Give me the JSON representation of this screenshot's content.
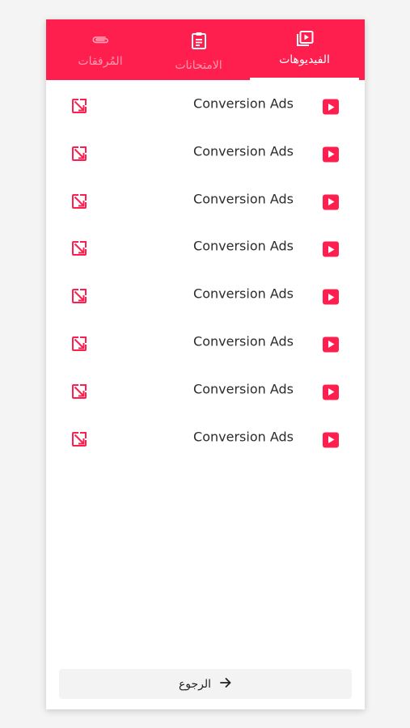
{
  "colors": {
    "accent": "#ff1f4f",
    "tab_inactive_text": "rgba(255,255,255,0.55)",
    "text": "#2b2b2b"
  },
  "tabs": [
    {
      "id": "videos",
      "label": "الفيديوهات",
      "icon": "video-library-icon",
      "active": true
    },
    {
      "id": "exams",
      "label": "الامتحانات",
      "icon": "clipboard-icon",
      "active": false
    },
    {
      "id": "attachments",
      "label": "المُرفقات",
      "icon": "paperclip-icon",
      "active": false
    }
  ],
  "items": [
    {
      "title": "Conversion Ads",
      "icon": "play-icon",
      "action_icon": "open-external-icon"
    },
    {
      "title": "Conversion Ads",
      "icon": "play-icon",
      "action_icon": "open-external-icon"
    },
    {
      "title": "Conversion Ads",
      "icon": "play-icon",
      "action_icon": "open-external-icon"
    },
    {
      "title": "Conversion Ads",
      "icon": "play-icon",
      "action_icon": "open-external-icon"
    },
    {
      "title": "Conversion Ads",
      "icon": "play-icon",
      "action_icon": "open-external-icon"
    },
    {
      "title": "Conversion Ads",
      "icon": "play-icon",
      "action_icon": "open-external-icon"
    },
    {
      "title": "Conversion Ads",
      "icon": "play-icon",
      "action_icon": "open-external-icon"
    },
    {
      "title": "Conversion Ads",
      "icon": "play-icon",
      "action_icon": "open-external-icon"
    }
  ],
  "back": {
    "label": "الرجوع",
    "icon": "arrow-right-icon"
  }
}
